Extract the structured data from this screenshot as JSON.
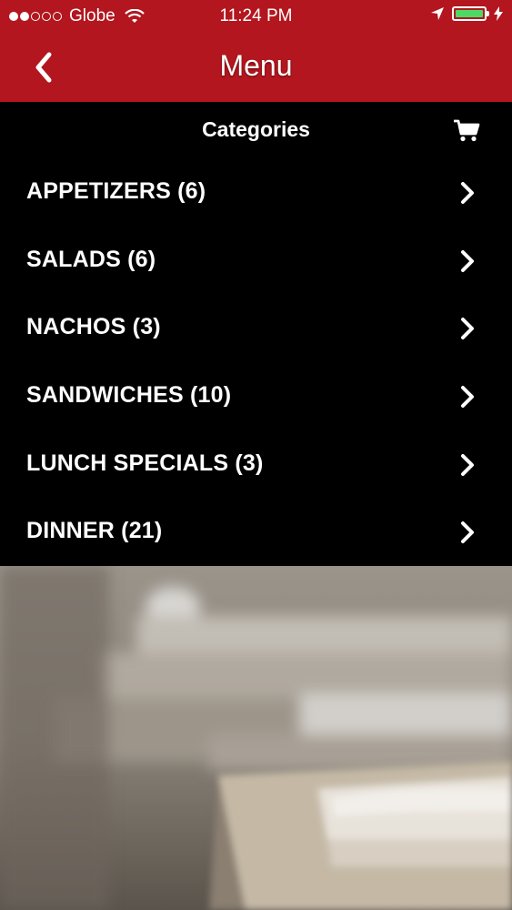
{
  "status_bar": {
    "carrier": "Globe",
    "time": "11:24 PM",
    "signal_dots_filled": 2,
    "signal_dots_total": 5,
    "battery_fraction": 1.0
  },
  "nav": {
    "title": "Menu",
    "back_icon": "chevron-left-icon"
  },
  "header": {
    "title": "Categories",
    "cart_icon": "cart-icon"
  },
  "categories": [
    {
      "label": "APPETIZERS (6)"
    },
    {
      "label": "SALADS (6)"
    },
    {
      "label": "NACHOS (3)"
    },
    {
      "label": "SANDWICHES (10)"
    },
    {
      "label": "LUNCH SPECIALS (3)"
    },
    {
      "label": "DINNER (21)"
    }
  ],
  "colors": {
    "brand_red": "#b3161e",
    "list_background": "#000000",
    "battery_green": "#4cd964",
    "text": "#ffffff"
  }
}
